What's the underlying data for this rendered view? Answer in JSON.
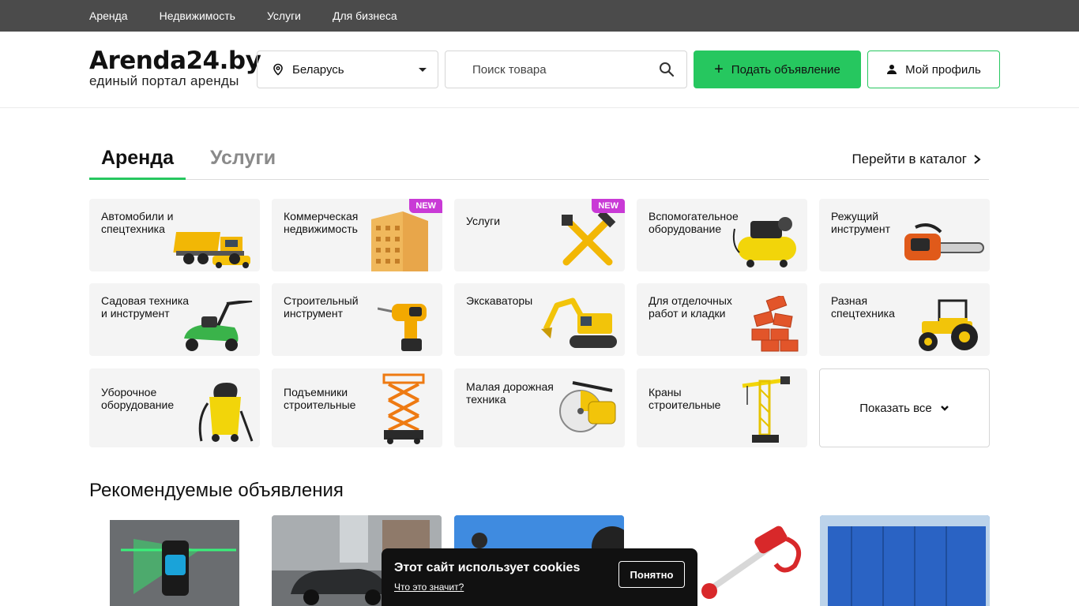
{
  "topnav": [
    "Аренда",
    "Недвижимость",
    "Услуги",
    "Для бизнеса"
  ],
  "logo": {
    "name": "Arenda24.by",
    "tagline": "единый портал аренды"
  },
  "region": {
    "label": "Беларусь"
  },
  "search": {
    "placeholder": "Поиск товара"
  },
  "buttons": {
    "post": "Подать объявление",
    "profile": "Мой профиль"
  },
  "tabs": {
    "active": "Аренда",
    "inactive": "Услуги"
  },
  "catalog_link": "Перейти в каталог",
  "categories": [
    {
      "label": "Автомобили и спецтехника",
      "icon": "dump-truck-icon"
    },
    {
      "label": "Коммерческая недвижимость",
      "icon": "building-icon",
      "badge": "NEW"
    },
    {
      "label": "Услуги",
      "icon": "tools-icon",
      "badge": "NEW"
    },
    {
      "label": "Вспомогательное оборудование",
      "icon": "compressor-icon"
    },
    {
      "label": "Режущий инструмент",
      "icon": "chainsaw-icon"
    },
    {
      "label": "Садовая техника и инструмент",
      "icon": "lawn-mower-icon"
    },
    {
      "label": "Строительный инструмент",
      "icon": "drill-icon"
    },
    {
      "label": "Экскаваторы",
      "icon": "excavator-icon"
    },
    {
      "label": "Для отделочных работ и кладки",
      "icon": "bricks-icon"
    },
    {
      "label": "Разная спецтехника",
      "icon": "tractor-icon"
    },
    {
      "label": "Уборочное оборудование",
      "icon": "vacuum-icon"
    },
    {
      "label": "Подъемники строительные",
      "icon": "scissor-lift-icon"
    },
    {
      "label": "Малая дорожная техника",
      "icon": "road-saw-icon"
    },
    {
      "label": "Краны строительные",
      "icon": "crane-icon"
    }
  ],
  "show_all": "Показать все",
  "recommended_title": "Рекомендуемые объявления",
  "cookie": {
    "title": "Этот сайт использует cookies",
    "link": "Что это значит?",
    "button": "Понятно"
  },
  "colors": {
    "accent": "#26c75f",
    "topbar": "#4b4b4b",
    "badge": "#c93ad6"
  }
}
